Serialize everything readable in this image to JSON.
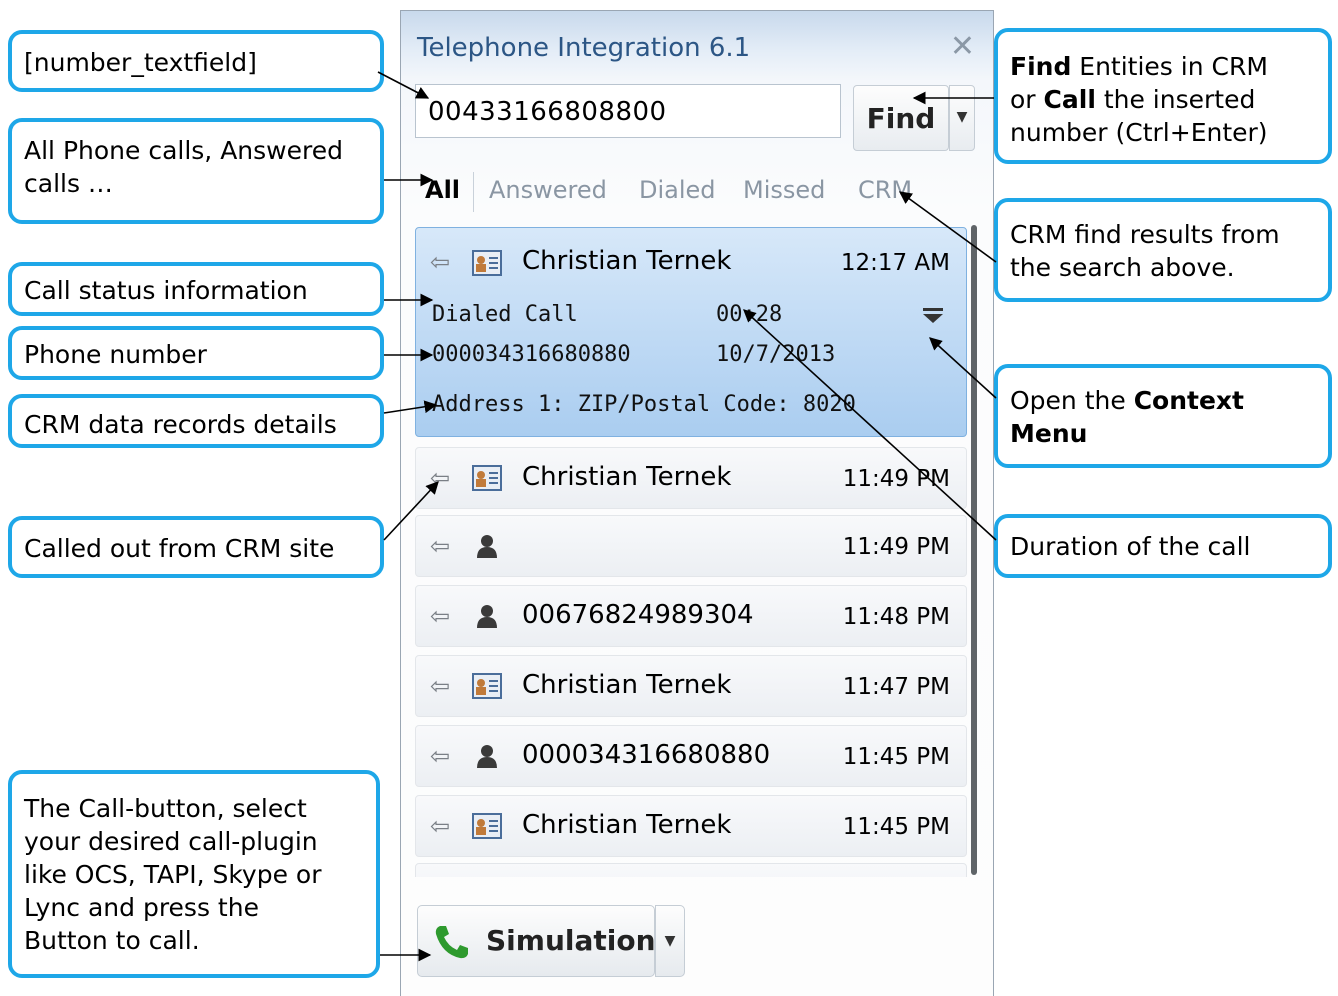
{
  "window": {
    "title": "Telephone Integration 6.1",
    "close_glyph": "✕",
    "number_value": "00433166808800",
    "find_label": "Find",
    "find_dropdown_glyph": "▼",
    "tabs": [
      "All",
      "Answered",
      "Dialed",
      "Missed",
      "CRM"
    ],
    "active_tab": "All",
    "selected_call": {
      "name": "Christian Ternek",
      "time": "12:17 AM",
      "status": "Dialed Call",
      "duration": "00:28",
      "number": "000034316680880",
      "date": "10/7/2013",
      "crm_detail": "Address 1: ZIP/Postal Code: 8020"
    },
    "calls": [
      {
        "icon": "contact-card-icon",
        "name": "Christian Ternek",
        "time": "11:49 PM"
      },
      {
        "icon": "person-icon",
        "name": "",
        "time": "11:49 PM"
      },
      {
        "icon": "person-icon",
        "name": "00676824989304",
        "time": "11:48 PM"
      },
      {
        "icon": "contact-card-icon",
        "name": "Christian Ternek",
        "time": "11:47 PM"
      },
      {
        "icon": "person-icon",
        "name": "000034316680880",
        "time": "11:45 PM"
      },
      {
        "icon": "contact-card-icon",
        "name": "Christian Ternek",
        "time": "11:45 PM"
      }
    ],
    "call_button_label": "Simulation",
    "call_dropdown_glyph": "▼"
  },
  "callouts": {
    "number_textfield": "[number_textfield]",
    "tabs_line1": "All Phone calls, Answered",
    "tabs_line2": "calls …",
    "status": "Call status information",
    "phone": "Phone number",
    "crm_details": "CRM data records details",
    "called_out": "Called out from CRM site",
    "call_button": [
      "The Call-button, select",
      "your desired call-plugin",
      "like OCS, TAPI, Skype or",
      "Lync and press the",
      "Button to call."
    ],
    "find": {
      "l1_bold": "Find",
      "l1_rest": " Entities in CRM",
      "l2_pre": "or ",
      "l2_bold": "Call",
      "l2_rest": " the inserted",
      "l3": "number (Ctrl+Enter)"
    },
    "crm_results": [
      "CRM find results from",
      "the search above."
    ],
    "context_menu": {
      "pre": "Open the ",
      "bold1": "Context",
      "bold2": "Menu"
    },
    "duration": "Duration of the call"
  },
  "colors": {
    "callout_border": "#1ea7e8",
    "selected_row": "#aacdf0",
    "title_text": "#2c5685"
  }
}
